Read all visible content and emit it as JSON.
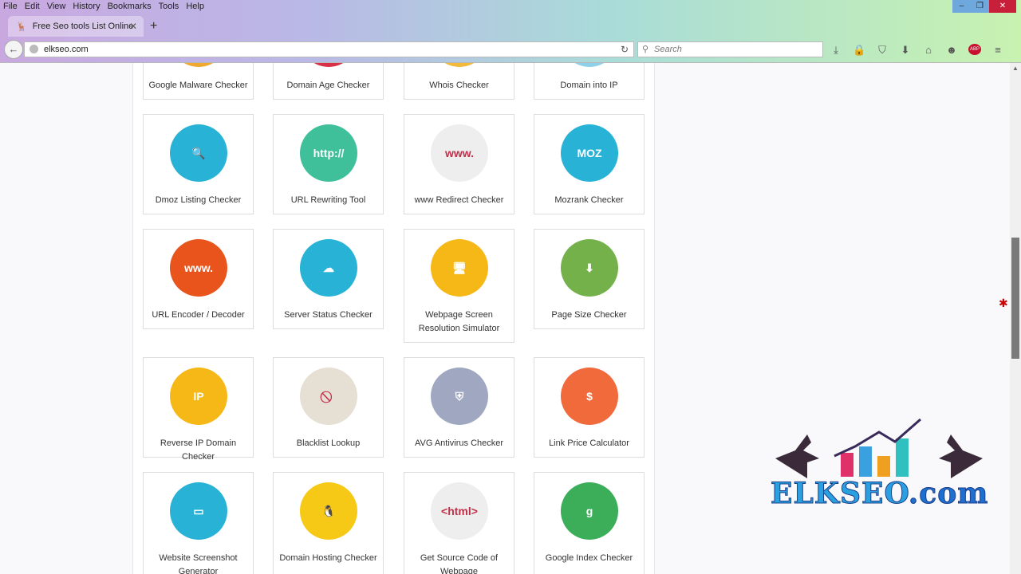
{
  "menu": [
    "File",
    "Edit",
    "View",
    "History",
    "Bookmarks",
    "Tools",
    "Help"
  ],
  "tab": {
    "title": "Free Seo tools List Online"
  },
  "address": {
    "url": "elkseo.com"
  },
  "search": {
    "placeholder": "Search"
  },
  "tools": [
    {
      "label": "Google Malware Checker",
      "color": "#f0a830"
    },
    {
      "label": "Domain Age Checker",
      "color": "#d9304a"
    },
    {
      "label": "Whois Checker",
      "color": "#f2b93b"
    },
    {
      "label": "Domain into IP",
      "color": "#8dd0e8"
    },
    {
      "label": "Dmoz Listing Checker",
      "color": "#27b2d6",
      "glyph": "🔍"
    },
    {
      "label": "URL Rewriting Tool",
      "color": "#3fbf9a",
      "glyph": "http://"
    },
    {
      "label": "www Redirect Checker",
      "color": "#eeeeee",
      "glyph": "www."
    },
    {
      "label": "Mozrank Checker",
      "color": "#27b2d6",
      "glyph": "MOZ"
    },
    {
      "label": "URL Encoder / Decoder",
      "color": "#e8541c",
      "glyph": "www."
    },
    {
      "label": "Server Status Checker",
      "color": "#27b2d6",
      "glyph": "☁"
    },
    {
      "label": "Webpage Screen Resolution Simulator",
      "color": "#f6b817",
      "glyph": "🖥"
    },
    {
      "label": "Page Size Checker",
      "color": "#74b14a",
      "glyph": "⬇"
    },
    {
      "label": "Reverse IP Domain Checker",
      "color": "#f6b817",
      "glyph": "IP"
    },
    {
      "label": "Blacklist Lookup",
      "color": "#e6e0d4",
      "glyph": "⃠"
    },
    {
      "label": "AVG Antivirus Checker",
      "color": "#9fa8c0",
      "glyph": "⛨"
    },
    {
      "label": "Link Price Calculator",
      "color": "#f06a3c",
      "glyph": "$"
    },
    {
      "label": "Website Screenshot Generator",
      "color": "#27b2d6",
      "glyph": "▭"
    },
    {
      "label": "Domain Hosting Checker",
      "color": "#f6c917",
      "glyph": "🐧"
    },
    {
      "label": "Get Source Code of Webpage",
      "color": "#eeeeee",
      "glyph": "<html>"
    },
    {
      "label": "Google Index Checker",
      "color": "#3cae5a",
      "glyph": "g"
    }
  ],
  "logo": {
    "text": "ELKSEO",
    "suffix": ".com"
  }
}
